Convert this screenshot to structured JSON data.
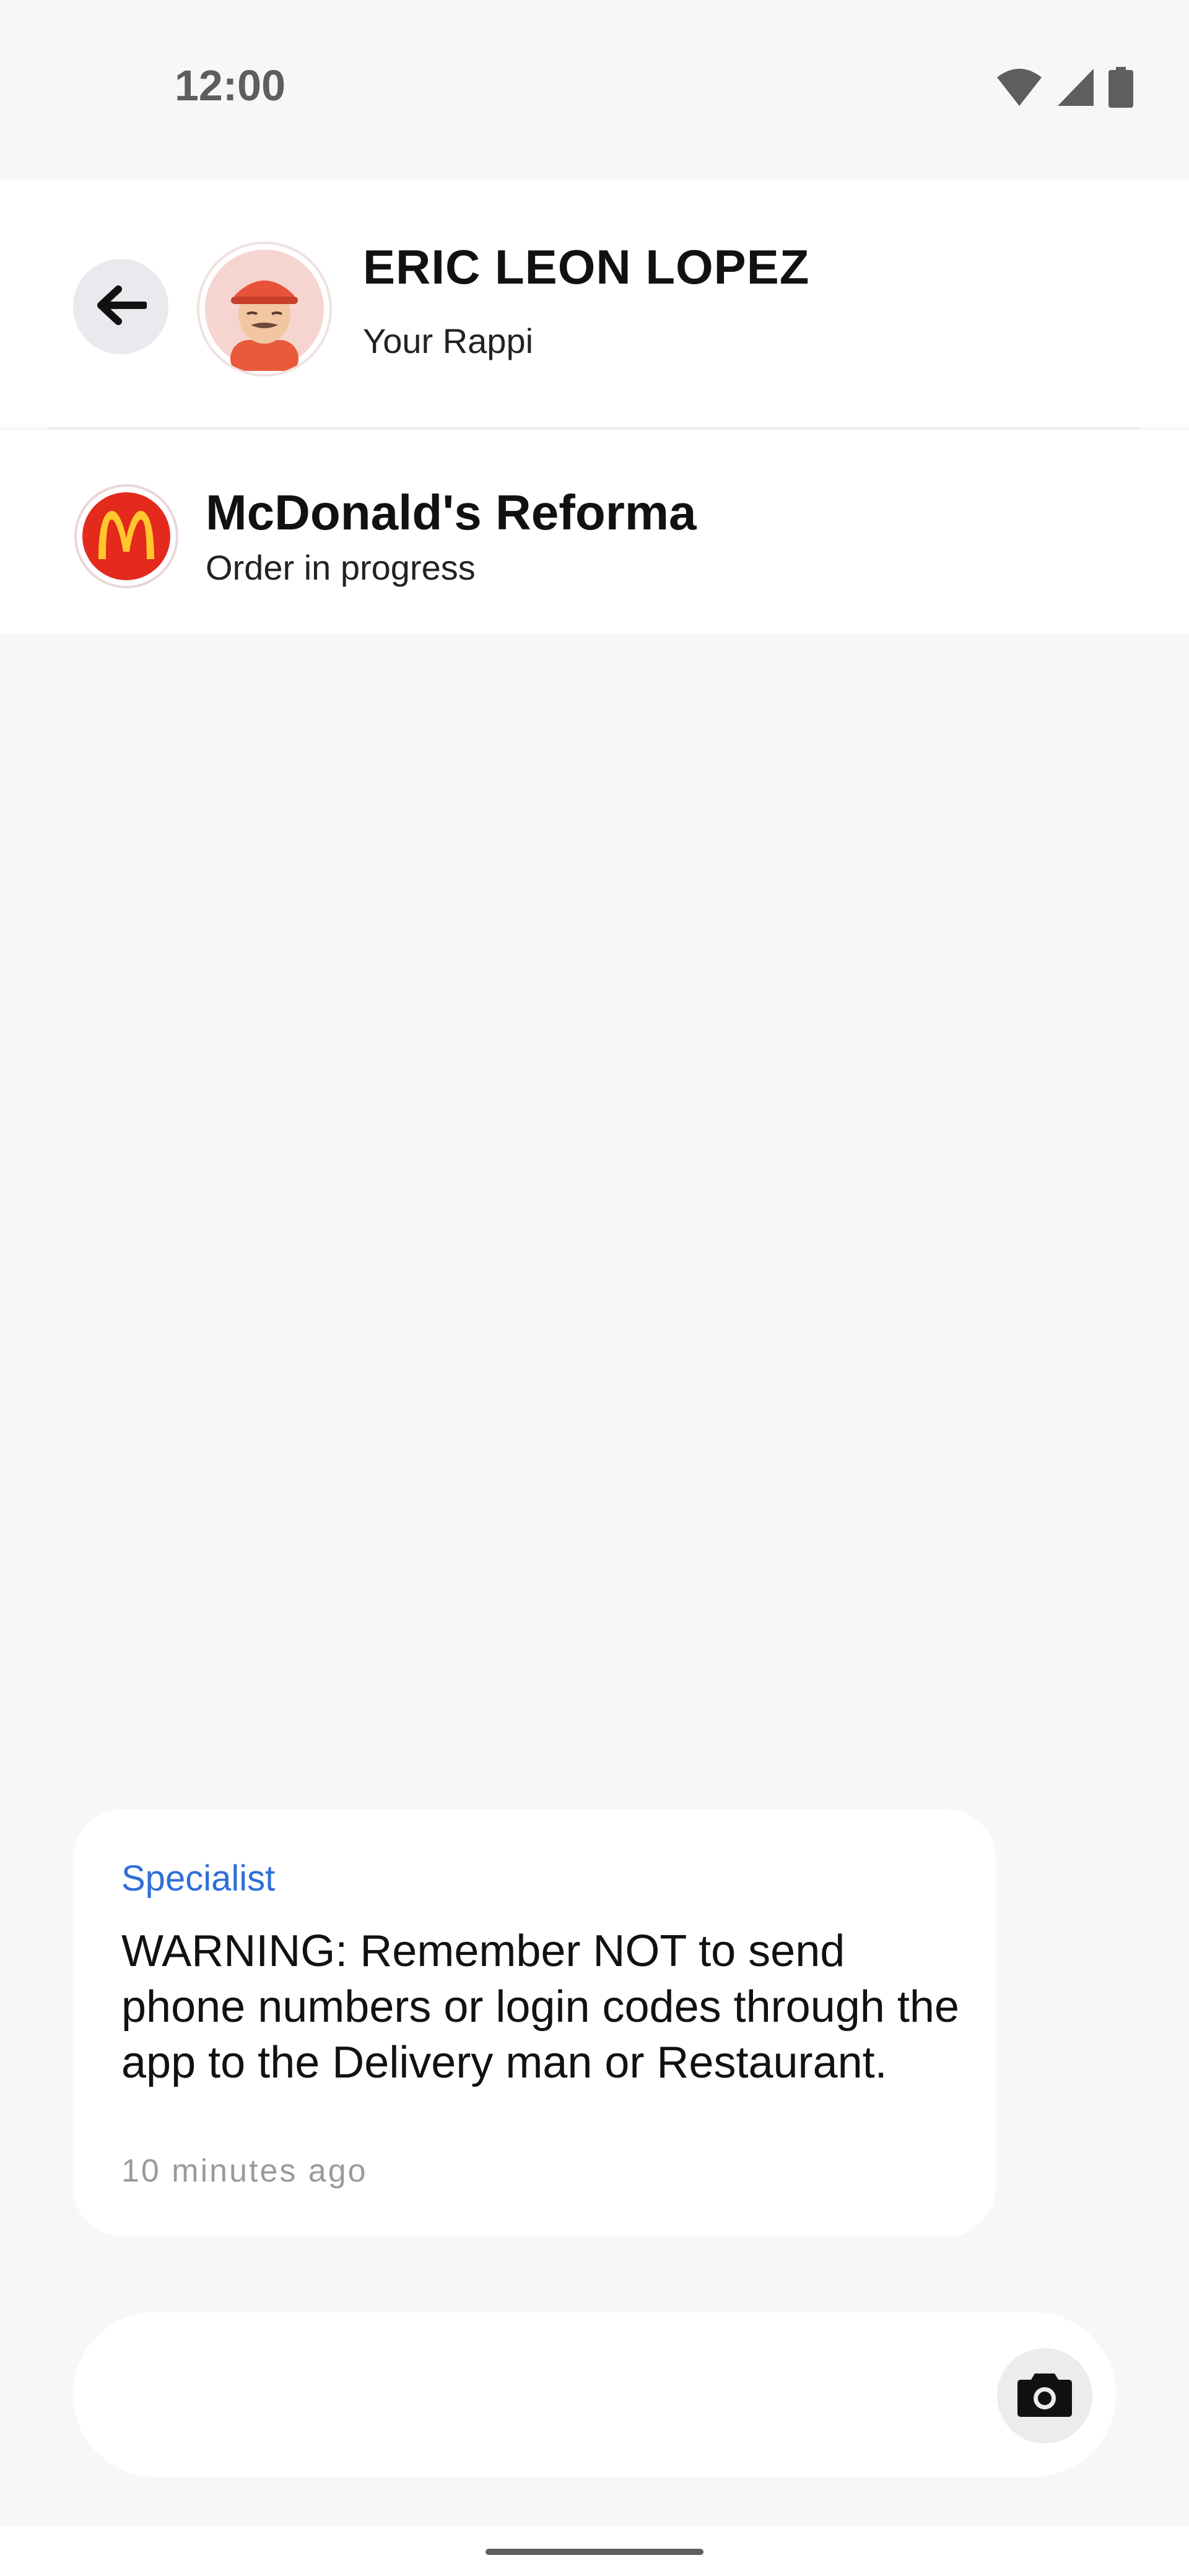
{
  "status_bar": {
    "time": "12:00",
    "icons": [
      "wifi-icon",
      "signal-icon",
      "battery-icon"
    ]
  },
  "header": {
    "back_icon": "back-arrow-icon",
    "courier_name": "ERIC LEON LOPEZ",
    "courier_role": "Your Rappi"
  },
  "store": {
    "name": "McDonald's Reforma",
    "status": "Order in progress",
    "logo_icon": "mcdonalds-logo-icon"
  },
  "messages": [
    {
      "sender": "Specialist",
      "text": "WARNING: Remember NOT to send phone numbers or login codes through the app to the Delivery man or Restaurant.",
      "time": "10 minutes ago"
    }
  ],
  "composer": {
    "camera_icon": "camera-icon"
  },
  "colors": {
    "accent_blue": "#2e6fd8",
    "background": "#f7f7f7",
    "mcdonalds_red": "#e42a1d",
    "mcdonalds_yellow": "#ffc72c"
  }
}
